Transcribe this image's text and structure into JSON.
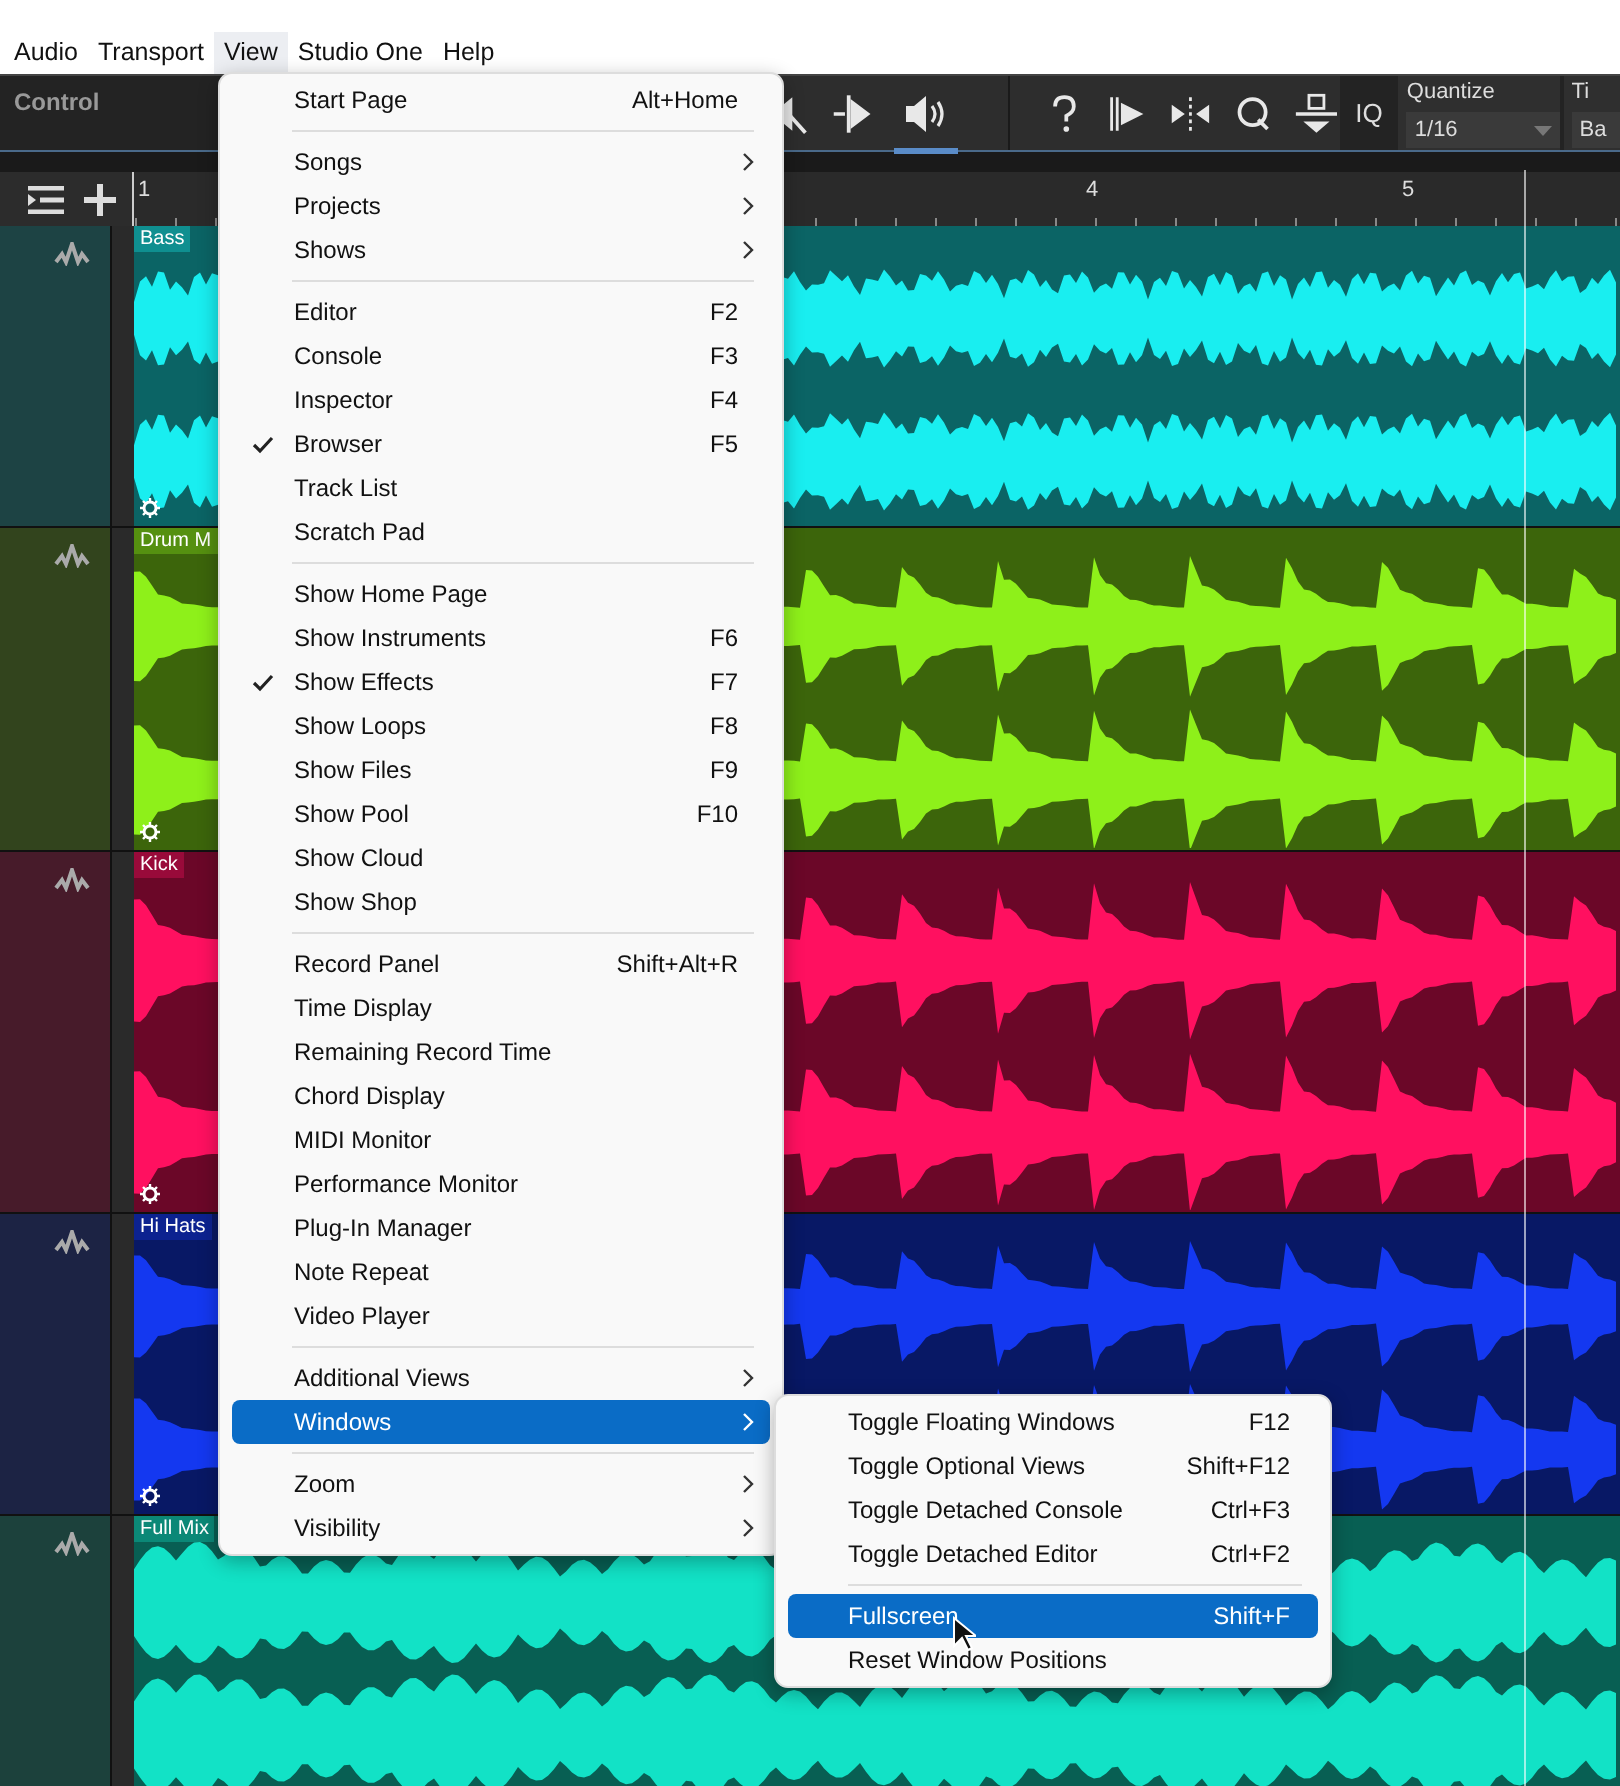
{
  "menubar": [
    {
      "label": "Audio",
      "selected": false
    },
    {
      "label": "Transport",
      "selected": false
    },
    {
      "label": "View",
      "selected": true
    },
    {
      "label": "Studio One",
      "selected": false
    },
    {
      "label": "Help",
      "selected": false
    }
  ],
  "toolbar": {
    "title": "Control",
    "iq": "IQ",
    "quantize_label": "Quantize",
    "quantize_value": "1/16",
    "column_3_label": "Ti",
    "column_3_value": "Ba"
  },
  "ruler": {
    "marks": [
      "1",
      "4",
      "5"
    ]
  },
  "tracks": [
    {
      "name": "Bass",
      "color": "#19eef0",
      "gear": true
    },
    {
      "name": "Drum M",
      "color": "#8ef01a",
      "gear": true
    },
    {
      "name": "Kick",
      "color": "#ff1060",
      "gear": true
    },
    {
      "name": "Hi Hats",
      "color": "#1438f0",
      "gear": true
    },
    {
      "name": "Full Mix",
      "color": "#12e2c6",
      "gear": false
    }
  ],
  "view_menu": [
    {
      "kind": "item",
      "label": "Start Page",
      "shortcut": "Alt+Home",
      "checked": false,
      "submenu": false,
      "selected": false
    },
    {
      "kind": "separator"
    },
    {
      "kind": "item",
      "label": "Songs",
      "checked": false,
      "submenu": true,
      "selected": false
    },
    {
      "kind": "item",
      "label": "Projects",
      "checked": false,
      "submenu": true,
      "selected": false
    },
    {
      "kind": "item",
      "label": "Shows",
      "checked": false,
      "submenu": true,
      "selected": false
    },
    {
      "kind": "separator"
    },
    {
      "kind": "item",
      "label": "Editor",
      "shortcut": "F2",
      "checked": false,
      "submenu": false,
      "selected": false
    },
    {
      "kind": "item",
      "label": "Console",
      "shortcut": "F3",
      "checked": false,
      "submenu": false,
      "selected": false
    },
    {
      "kind": "item",
      "label": "Inspector",
      "shortcut": "F4",
      "checked": false,
      "submenu": false,
      "selected": false
    },
    {
      "kind": "item",
      "label": "Browser",
      "shortcut": "F5",
      "checked": true,
      "submenu": false,
      "selected": false
    },
    {
      "kind": "item",
      "label": "Track List",
      "checked": false,
      "submenu": false,
      "selected": false
    },
    {
      "kind": "item",
      "label": "Scratch Pad",
      "checked": false,
      "submenu": false,
      "selected": false
    },
    {
      "kind": "separator"
    },
    {
      "kind": "item",
      "label": "Show Home Page",
      "checked": false,
      "submenu": false,
      "selected": false
    },
    {
      "kind": "item",
      "label": "Show Instruments",
      "shortcut": "F6",
      "checked": false,
      "submenu": false,
      "selected": false
    },
    {
      "kind": "item",
      "label": "Show Effects",
      "shortcut": "F7",
      "checked": true,
      "submenu": false,
      "selected": false
    },
    {
      "kind": "item",
      "label": "Show Loops",
      "shortcut": "F8",
      "checked": false,
      "submenu": false,
      "selected": false
    },
    {
      "kind": "item",
      "label": "Show Files",
      "shortcut": "F9",
      "checked": false,
      "submenu": false,
      "selected": false
    },
    {
      "kind": "item",
      "label": "Show Pool",
      "shortcut": "F10",
      "checked": false,
      "submenu": false,
      "selected": false
    },
    {
      "kind": "item",
      "label": "Show Cloud",
      "checked": false,
      "submenu": false,
      "selected": false
    },
    {
      "kind": "item",
      "label": "Show Shop",
      "checked": false,
      "submenu": false,
      "selected": false
    },
    {
      "kind": "separator"
    },
    {
      "kind": "item",
      "label": "Record Panel",
      "shortcut": "Shift+Alt+R",
      "checked": false,
      "submenu": false,
      "selected": false
    },
    {
      "kind": "item",
      "label": "Time Display",
      "checked": false,
      "submenu": false,
      "selected": false
    },
    {
      "kind": "item",
      "label": "Remaining Record Time",
      "checked": false,
      "submenu": false,
      "selected": false
    },
    {
      "kind": "item",
      "label": "Chord Display",
      "checked": false,
      "submenu": false,
      "selected": false
    },
    {
      "kind": "item",
      "label": "MIDI Monitor",
      "checked": false,
      "submenu": false,
      "selected": false
    },
    {
      "kind": "item",
      "label": "Performance Monitor",
      "checked": false,
      "submenu": false,
      "selected": false
    },
    {
      "kind": "item",
      "label": "Plug-In Manager",
      "checked": false,
      "submenu": false,
      "selected": false
    },
    {
      "kind": "item",
      "label": "Note Repeat",
      "checked": false,
      "submenu": false,
      "selected": false
    },
    {
      "kind": "item",
      "label": "Video Player",
      "checked": false,
      "submenu": false,
      "selected": false
    },
    {
      "kind": "separator"
    },
    {
      "kind": "item",
      "label": "Additional Views",
      "checked": false,
      "submenu": true,
      "selected": false
    },
    {
      "kind": "item",
      "label": "Windows",
      "checked": false,
      "submenu": true,
      "selected": true
    },
    {
      "kind": "separator"
    },
    {
      "kind": "item",
      "label": "Zoom",
      "checked": false,
      "submenu": true,
      "selected": false
    },
    {
      "kind": "item",
      "label": "Visibility",
      "checked": false,
      "submenu": true,
      "selected": false
    }
  ],
  "windows_submenu": [
    {
      "kind": "item",
      "label": "Toggle Floating Windows",
      "shortcut": "F12",
      "selected": false
    },
    {
      "kind": "item",
      "label": "Toggle Optional Views",
      "shortcut": "Shift+F12",
      "selected": false
    },
    {
      "kind": "item",
      "label": "Toggle Detached Console",
      "shortcut": "Ctrl+F3",
      "selected": false
    },
    {
      "kind": "item",
      "label": "Toggle Detached Editor",
      "shortcut": "Ctrl+F2",
      "selected": false
    },
    {
      "kind": "separator"
    },
    {
      "kind": "item",
      "label": "Fullscreen",
      "shortcut": "Shift+F",
      "selected": true
    },
    {
      "kind": "item",
      "label": "Reset Window Positions",
      "selected": false
    }
  ]
}
